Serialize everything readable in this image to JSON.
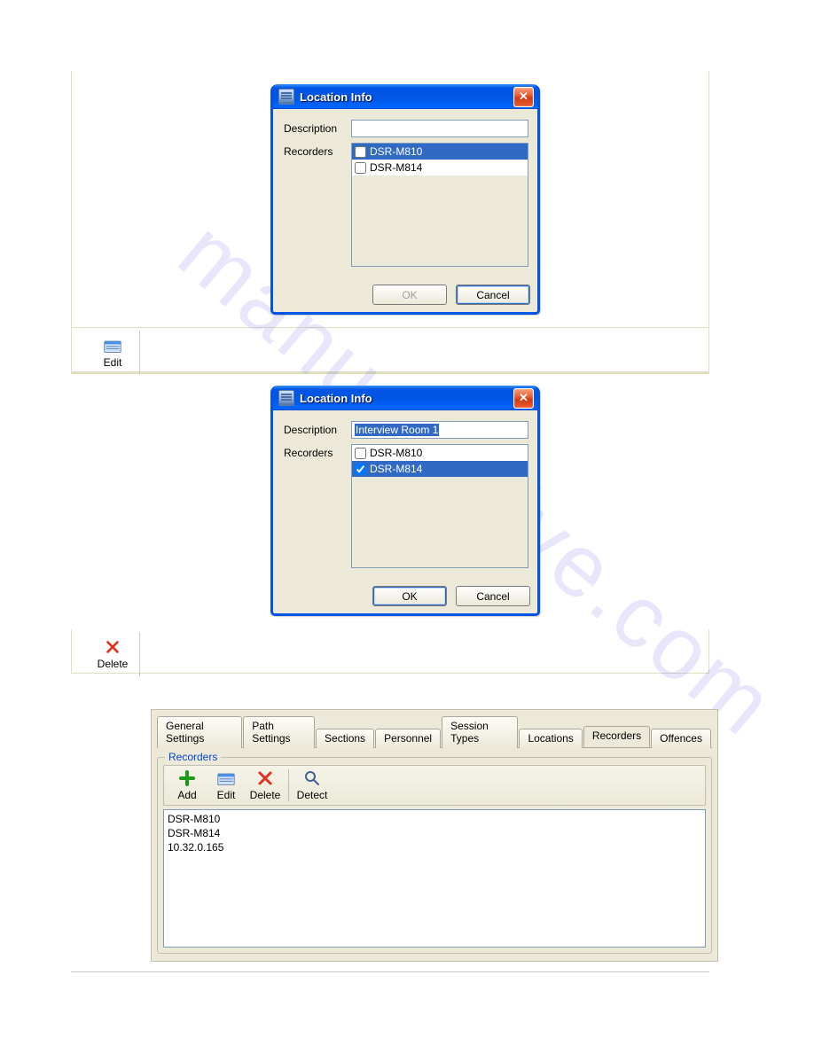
{
  "watermark": "manualshive.com",
  "dialog1": {
    "title": "Location Info",
    "descLabel": "Description",
    "descValue": "",
    "recLabel": "Recorders",
    "recorders": [
      {
        "name": "DSR-M810",
        "checked": false,
        "highlighted": true
      },
      {
        "name": "DSR-M814",
        "checked": false,
        "highlighted": false
      }
    ],
    "ok": "OK",
    "cancel": "Cancel",
    "okDisabled": true
  },
  "editCell": {
    "label": "Edit"
  },
  "dialog2": {
    "title": "Location Info",
    "descLabel": "Description",
    "descValue": "Interview Room 1",
    "recLabel": "Recorders",
    "recorders": [
      {
        "name": "DSR-M810",
        "checked": false,
        "highlighted": false
      },
      {
        "name": "DSR-M814",
        "checked": true,
        "highlighted": true
      }
    ],
    "ok": "OK",
    "cancel": "Cancel",
    "okDisabled": false
  },
  "deleteCell": {
    "label": "Delete"
  },
  "panel": {
    "tabs": [
      "General Settings",
      "Path Settings",
      "Sections",
      "Personnel",
      "Session Types",
      "Locations",
      "Recorders",
      "Offences"
    ],
    "activeTab": "Recorders",
    "groupTitle": "Recorders",
    "tools": {
      "add": "Add",
      "edit": "Edit",
      "delete": "Delete",
      "detect": "Detect"
    },
    "items": [
      "DSR-M810",
      "DSR-M814",
      "10.32.0.165"
    ]
  }
}
